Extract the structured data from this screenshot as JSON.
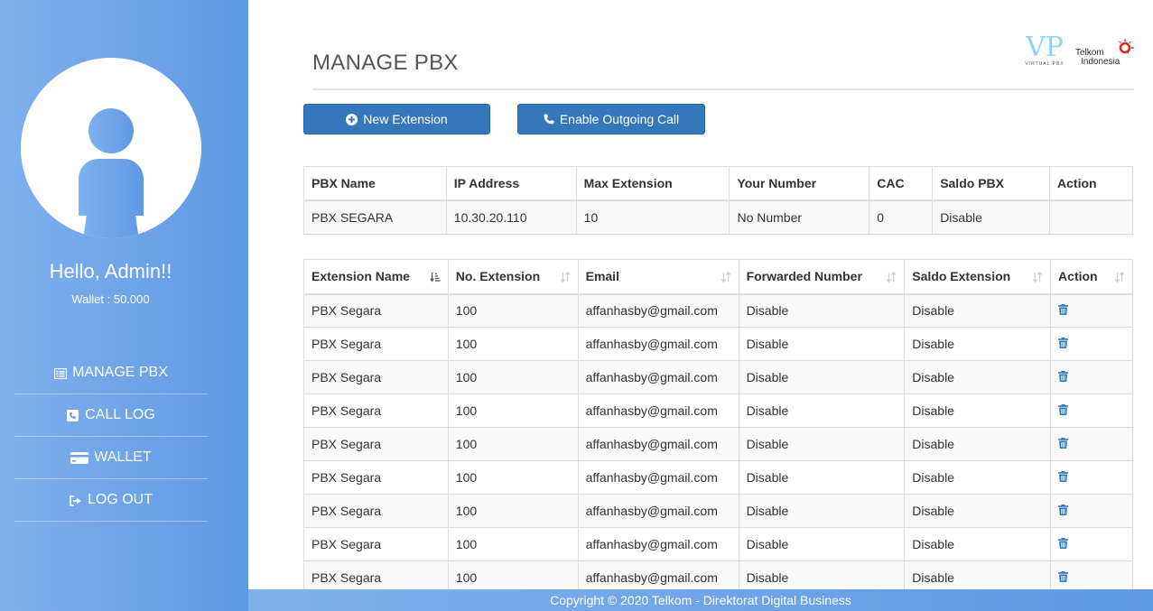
{
  "sidebar": {
    "greeting": "Hello, Admin!!",
    "wallet": "Wallet : 50.000",
    "nav": [
      {
        "label": "MANAGE PBX",
        "icon": "list-alt-icon"
      },
      {
        "label": "CALL LOG",
        "icon": "phone-square-icon"
      },
      {
        "label": "WALLET",
        "icon": "credit-card-icon"
      },
      {
        "label": "LOG OUT",
        "icon": "sign-out-icon"
      }
    ]
  },
  "header": {
    "title": "MANAGE PBX",
    "logo_vp_text": "VP",
    "logo_vp_sub": "VIRTUAL PBX",
    "logo_telkom_line1": "Telkom",
    "logo_telkom_line2": "Indonesia"
  },
  "buttons": {
    "new_extension": "New Extension",
    "enable_outgoing": "Enable Outgoing Call"
  },
  "pbx_table": {
    "headers": [
      "PBX Name",
      "IP Address",
      "Max Extension",
      "Your Number",
      "CAC",
      "Saldo PBX",
      "Action"
    ],
    "row": [
      "PBX SEGARA",
      "10.30.20.110",
      "10",
      "No Number",
      "0",
      "Disable",
      ""
    ]
  },
  "ext_table": {
    "headers": [
      "Extension Name",
      "No. Extension",
      "Email",
      "Forwarded Number",
      "Saldo Extension",
      "Action"
    ],
    "rows": [
      [
        "PBX Segara",
        "100",
        "affanhasby@gmail.com",
        "Disable",
        "Disable"
      ],
      [
        "PBX Segara",
        "100",
        "affanhasby@gmail.com",
        "Disable",
        "Disable"
      ],
      [
        "PBX Segara",
        "100",
        "affanhasby@gmail.com",
        "Disable",
        "Disable"
      ],
      [
        "PBX Segara",
        "100",
        "affanhasby@gmail.com",
        "Disable",
        "Disable"
      ],
      [
        "PBX Segara",
        "100",
        "affanhasby@gmail.com",
        "Disable",
        "Disable"
      ],
      [
        "PBX Segara",
        "100",
        "affanhasby@gmail.com",
        "Disable",
        "Disable"
      ],
      [
        "PBX Segara",
        "100",
        "affanhasby@gmail.com",
        "Disable",
        "Disable"
      ],
      [
        "PBX Segara",
        "100",
        "affanhasby@gmail.com",
        "Disable",
        "Disable"
      ],
      [
        "PBX Segara",
        "100",
        "affanhasby@gmail.com",
        "Disable",
        "Disable"
      ]
    ]
  },
  "footer": {
    "text": "Copyright © 2020 Telkom - Direktorat Digital Business"
  },
  "colors": {
    "sidebar_gradient_start": "#7fb1ee",
    "sidebar_gradient_end": "#5f98e3",
    "button": "#3478bb",
    "trash": "#3478bb"
  }
}
